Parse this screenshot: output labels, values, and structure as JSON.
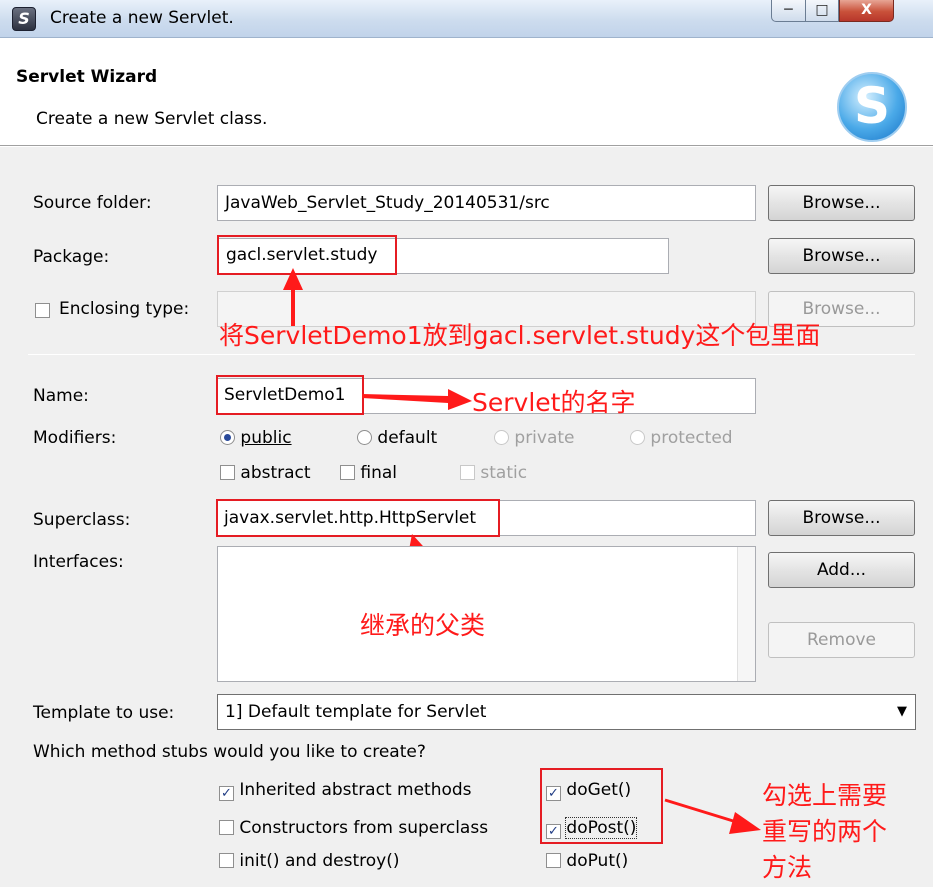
{
  "window": {
    "title": "Create a new Servlet."
  },
  "banner": {
    "title": "Servlet Wizard",
    "description": "Create a new Servlet class."
  },
  "source_folder": {
    "label": "Source folder:",
    "value": "JavaWeb_Servlet_Study_20140531/src",
    "browse": "Browse..."
  },
  "package": {
    "label": "Package:",
    "value": "gacl.servlet.study",
    "browse": "Browse..."
  },
  "enclosing": {
    "label": "Enclosing type:",
    "checked": false,
    "value": "",
    "browse": "Browse..."
  },
  "name": {
    "label": "Name:",
    "value": "ServletDemo1"
  },
  "modifiers": {
    "label": "Modifiers:",
    "access": [
      {
        "label": "public",
        "selected": true,
        "enabled": true
      },
      {
        "label": "default",
        "selected": false,
        "enabled": true
      },
      {
        "label": "private",
        "selected": false,
        "enabled": false
      },
      {
        "label": "protected",
        "selected": false,
        "enabled": false
      }
    ],
    "flags": [
      {
        "label": "abstract",
        "checked": false,
        "enabled": true
      },
      {
        "label": "final",
        "checked": false,
        "enabled": true
      },
      {
        "label": "static",
        "checked": false,
        "enabled": false
      }
    ]
  },
  "superclass": {
    "label": "Superclass:",
    "value": "javax.servlet.http.HttpServlet",
    "browse": "Browse..."
  },
  "interfaces": {
    "label": "Interfaces:",
    "add": "Add...",
    "remove": "Remove"
  },
  "template": {
    "label": "Template to use:",
    "value": "1] Default template for Servlet"
  },
  "stubs": {
    "question": "Which method stubs would you like to create?",
    "options": [
      {
        "label": "Inherited abstract methods",
        "checked": true
      },
      {
        "label": "Constructors from superclass",
        "checked": false
      },
      {
        "label": "init() and destroy()",
        "checked": false
      },
      {
        "label": "doGet()",
        "checked": true
      },
      {
        "label": "doPost()",
        "checked": true
      },
      {
        "label": "doPut()",
        "checked": false
      }
    ]
  },
  "annotations": {
    "package_note": "将ServletDemo1放到gacl.servlet.study这个包里面",
    "name_note": "Servlet的名字",
    "superclass_note": "继承的父类",
    "methods_note_1": "勾选上需要",
    "methods_note_2": "重写的两个",
    "methods_note_3": "方法",
    "color": "#ff1a1a"
  }
}
